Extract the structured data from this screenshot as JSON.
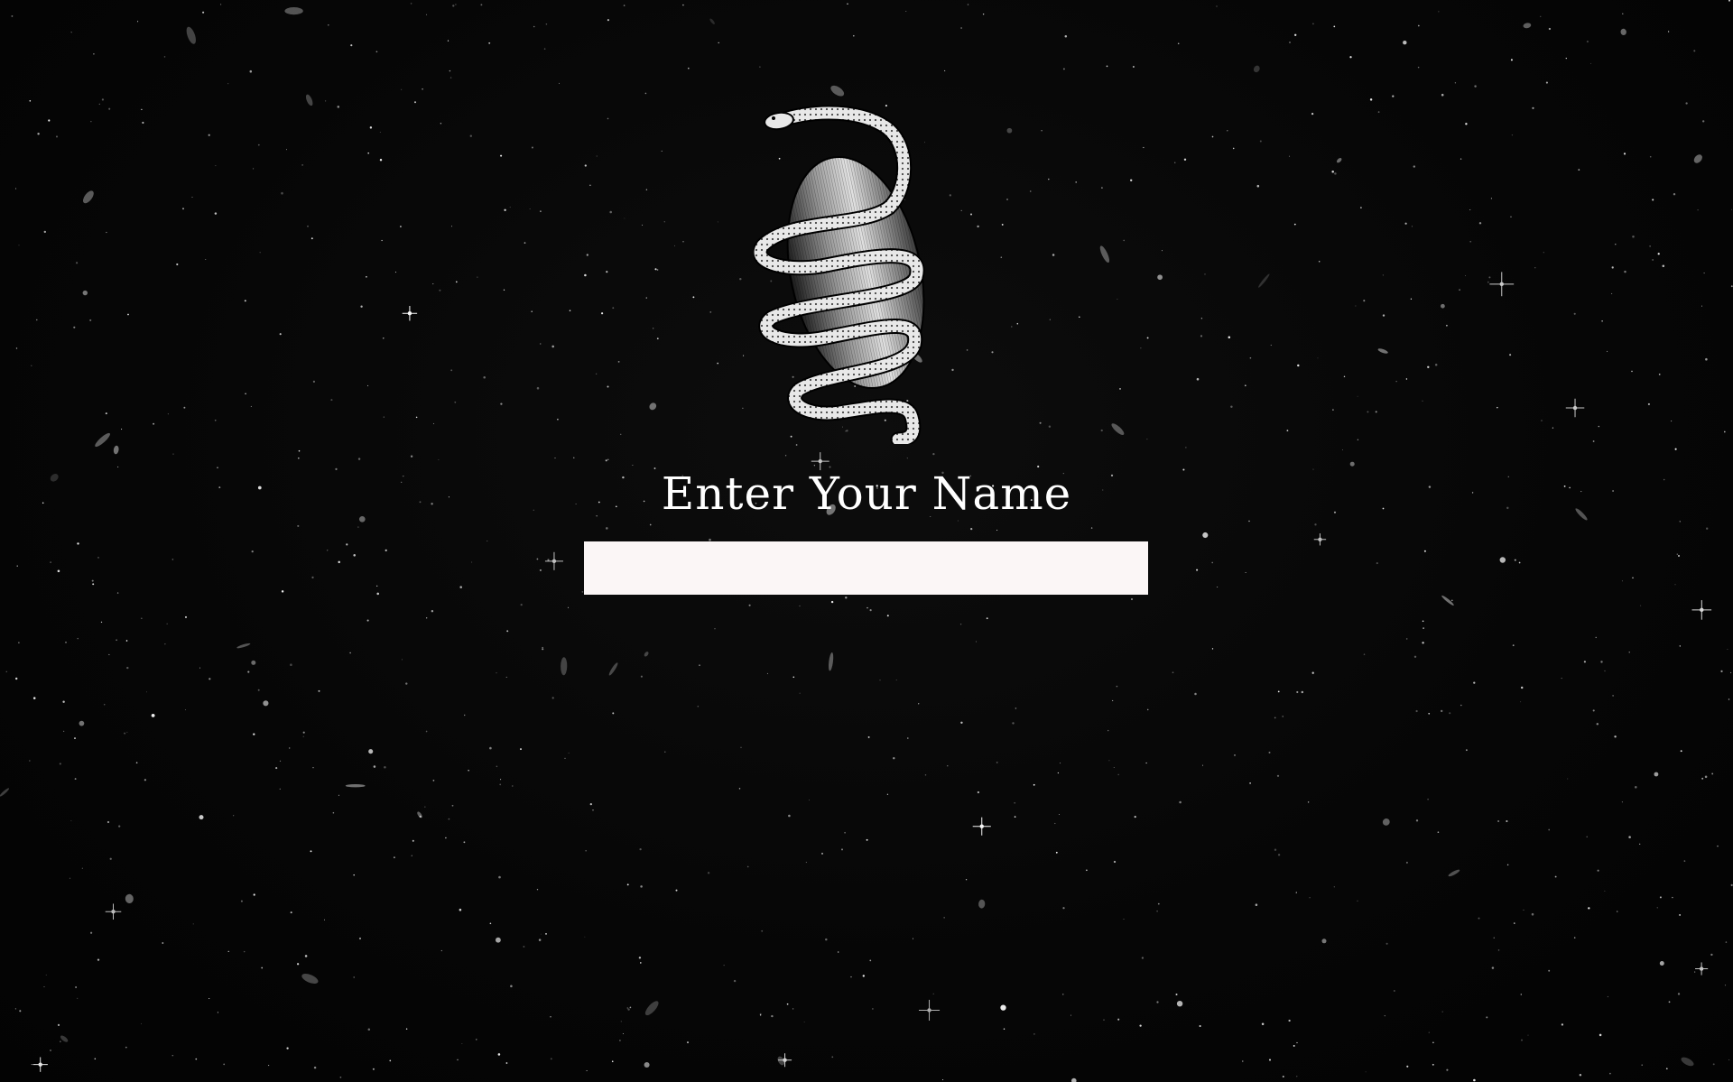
{
  "page": {
    "background_color": "#050505",
    "emblem_icon": "snake-coiled-around-egg-icon",
    "prompt_label": "Enter Your Name",
    "name_input": {
      "value": "",
      "placeholder": ""
    },
    "colors": {
      "prompt_text": "#ffffff",
      "input_background": "#fbf6f6"
    }
  }
}
